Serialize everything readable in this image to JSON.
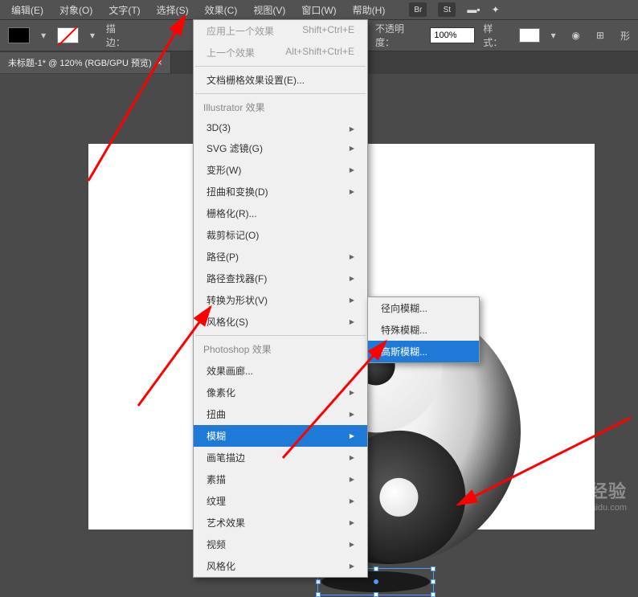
{
  "menubar": {
    "items": [
      "编辑(E)",
      "对象(O)",
      "文字(T)",
      "选择(S)",
      "效果(C)",
      "视图(V)",
      "窗口(W)",
      "帮助(H)"
    ],
    "icons": [
      "Br",
      "St"
    ]
  },
  "toolbar": {
    "stroke_label": "描边：",
    "opacity_label": "不透明度：",
    "opacity_value": "100%",
    "style_label": "样式："
  },
  "tab": {
    "title": "未标题-1* @ 120% (RGB/GPU 预览)"
  },
  "menu": {
    "top": [
      {
        "label": "应用上一个效果",
        "shortcut": "Shift+Ctrl+E",
        "disabled": true
      },
      {
        "label": "上一个效果",
        "shortcut": "Alt+Shift+Ctrl+E",
        "disabled": true
      }
    ],
    "doc_raster": "文档栅格效果设置(E)...",
    "illustrator_header": "Illustrator 效果",
    "illustrator": [
      "3D(3)",
      "SVG 滤镜(G)",
      "变形(W)",
      "扭曲和变换(D)",
      "栅格化(R)...",
      "裁剪标记(O)",
      "路径(P)",
      "路径查找器(F)",
      "转换为形状(V)",
      "风格化(S)"
    ],
    "photoshop_header": "Photoshop 效果",
    "photoshop": [
      "效果画廊...",
      "像素化",
      "扭曲",
      "模糊",
      "画笔描边",
      "素描",
      "纹理",
      "艺术效果",
      "视频",
      "风格化"
    ],
    "blur_selected_index": 3
  },
  "submenu": {
    "items": [
      "径向模糊...",
      "特殊模糊...",
      "高斯模糊..."
    ],
    "selected_index": 2
  },
  "watermark": {
    "logo": "Baidu 经验",
    "url": "jingyan.baidu.com"
  }
}
